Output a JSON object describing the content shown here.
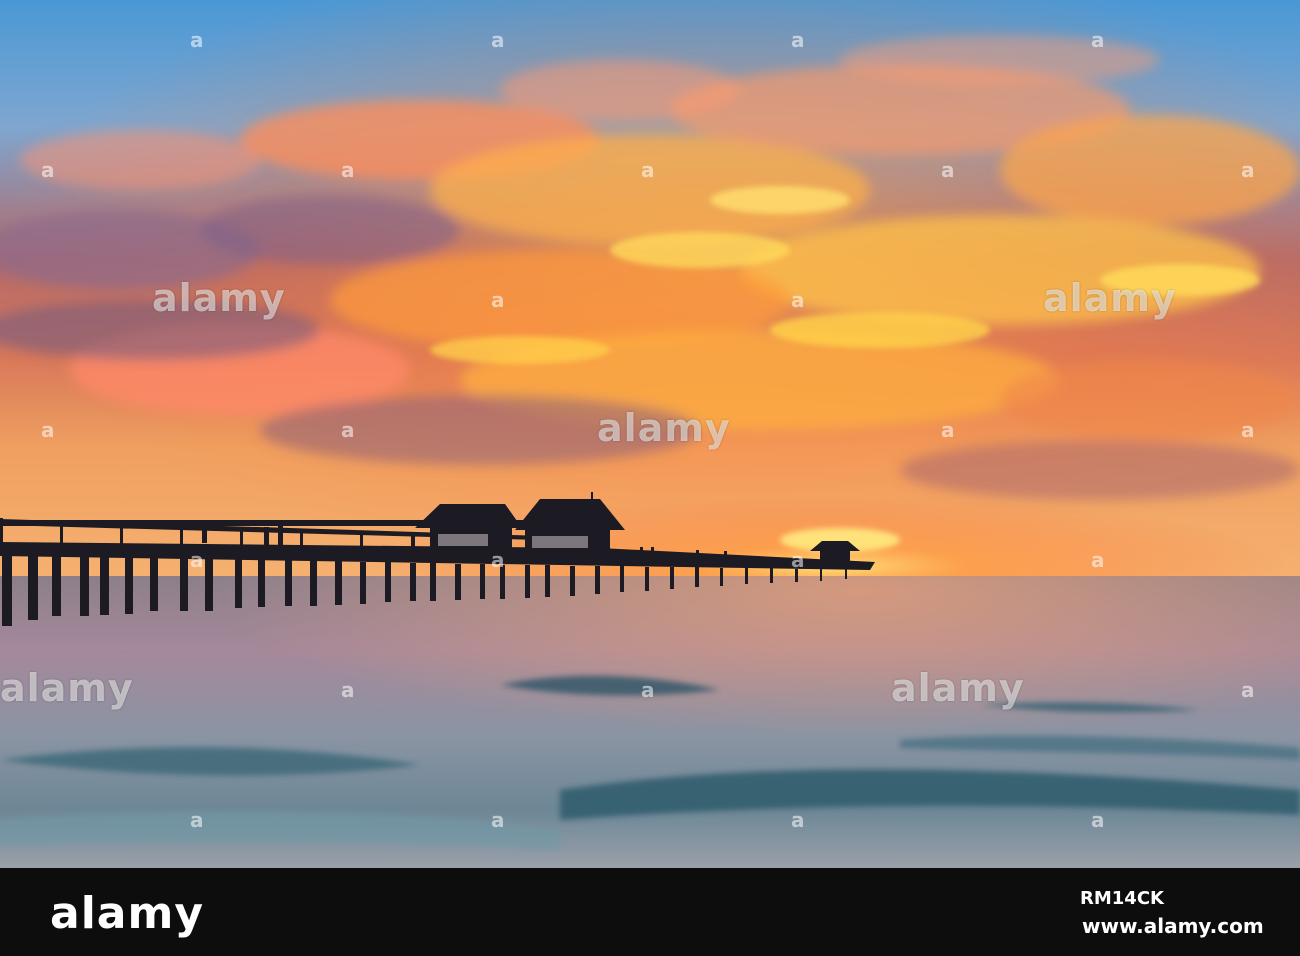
{
  "photo": {
    "colors": {
      "sky_top": "#3f8fd0",
      "sky_mid": "#c5704a",
      "horizon_glow": "#ffb347",
      "cloud_warm": "#ff8c3a",
      "cloud_gold": "#ffd34a",
      "cloud_purple": "#7a5a80",
      "sea_surface": "#9aa3ad",
      "sea_deep": "#3e6274",
      "pier_silhouette": "#1a1a22"
    }
  },
  "watermark": {
    "logo_text": "alamy",
    "corner_mark": "a"
  },
  "footer": {
    "logo": "alamy",
    "image_id": "RM14CK",
    "url": "www.alamy.com"
  }
}
